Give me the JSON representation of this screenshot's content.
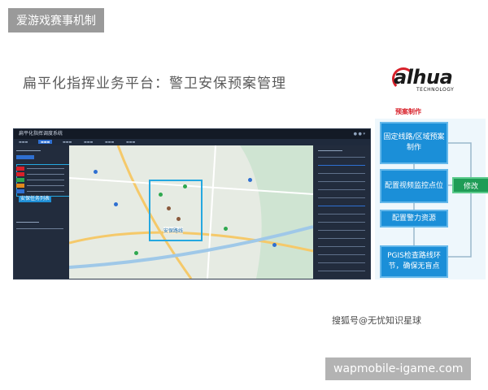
{
  "badge": "爱游戏赛事机制",
  "slide_title": "扁平化指挥业务平台：警卫安保预案管理",
  "logo": {
    "text": "alhua",
    "sub": "TECHNOLOGY"
  },
  "app": {
    "title": "扁平化指挥调度系统",
    "task_label": "安保任务列表",
    "route_label": "安保路线"
  },
  "flowchart": {
    "heading": "预案制作",
    "steps": [
      "固定线路/区域预案制作",
      "配置视频监控点位",
      "配置警力资源",
      "PGIS检查路线环节，确保无盲点"
    ],
    "edit_label": "修改"
  },
  "caption": "搜狐号@无忧知识星球",
  "watermark": "wapmobile-igame.com",
  "colors": {
    "accent": "#1b8fd8",
    "brand_red": "#d8212a",
    "edit_green": "#1f9c56"
  }
}
